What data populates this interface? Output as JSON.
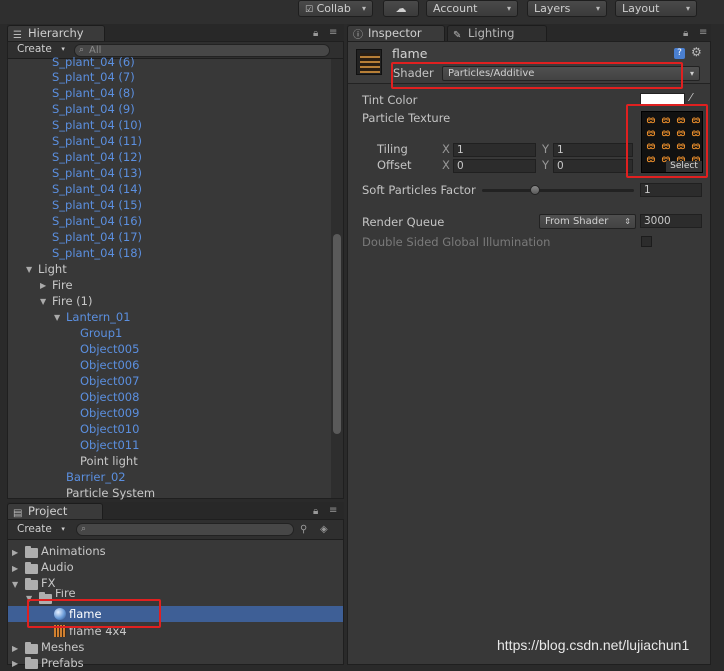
{
  "toolbar": {
    "collab": "Collab",
    "account": "Account",
    "layers": "Layers",
    "layout": "Layout"
  },
  "hierarchy": {
    "tab": "Hierarchy",
    "create": "Create",
    "search_placeholder": "All",
    "rows": [
      {
        "label": "S_plant_04 (6)"
      },
      {
        "label": "S_plant_04 (7)"
      },
      {
        "label": "S_plant_04 (8)"
      },
      {
        "label": "S_plant_04 (9)"
      },
      {
        "label": "S_plant_04 (10)"
      },
      {
        "label": "S_plant_04 (11)"
      },
      {
        "label": "S_plant_04 (12)"
      },
      {
        "label": "S_plant_04 (13)"
      },
      {
        "label": "S_plant_04 (14)"
      },
      {
        "label": "S_plant_04 (15)"
      },
      {
        "label": "S_plant_04 (16)"
      },
      {
        "label": "S_plant_04 (17)"
      },
      {
        "label": "S_plant_04 (18)"
      },
      {
        "label": "Light"
      },
      {
        "label": "Fire"
      },
      {
        "label": "Fire (1)"
      },
      {
        "label": "Lantern_01"
      },
      {
        "label": "Group1"
      },
      {
        "label": "Object005"
      },
      {
        "label": "Object006"
      },
      {
        "label": "Object007"
      },
      {
        "label": "Object008"
      },
      {
        "label": "Object009"
      },
      {
        "label": "Object010"
      },
      {
        "label": "Object011"
      },
      {
        "label": "Point light"
      },
      {
        "label": "Barrier_02"
      },
      {
        "label": "Particle System"
      }
    ]
  },
  "project": {
    "tab": "Project",
    "create": "Create",
    "items": [
      {
        "label": "Animations"
      },
      {
        "label": "Audio"
      },
      {
        "label": "FX"
      },
      {
        "label": "Fire"
      },
      {
        "label": "flame"
      },
      {
        "label": "flame 4x4"
      },
      {
        "label": "Meshes"
      },
      {
        "label": "Prefabs"
      }
    ]
  },
  "inspector": {
    "tab": "Inspector",
    "lighting_tab": "Lighting",
    "material_name": "flame",
    "shader_label": "Shader",
    "shader_value": "Particles/Additive",
    "tint_color": "Tint Color",
    "particle_texture": "Particle Texture",
    "tiling": "Tiling",
    "offset": "Offset",
    "x": "X",
    "y": "Y",
    "tiling_x": "1",
    "tiling_y": "1",
    "offset_x": "0",
    "offset_y": "0",
    "select": "Select",
    "soft_particles": "Soft Particles Factor",
    "soft_value": "1",
    "render_queue": "Render Queue",
    "render_queue_mode": "From Shader",
    "render_queue_value": "3000",
    "double_sided": "Double Sided Global Illumination"
  },
  "watermark": "https://blog.csdn.net/lujiachun1",
  "colors": {
    "accent_blue": "#5b8fdf",
    "highlight_red": "#e02020",
    "sprite_orange": "#ff9a2e"
  }
}
